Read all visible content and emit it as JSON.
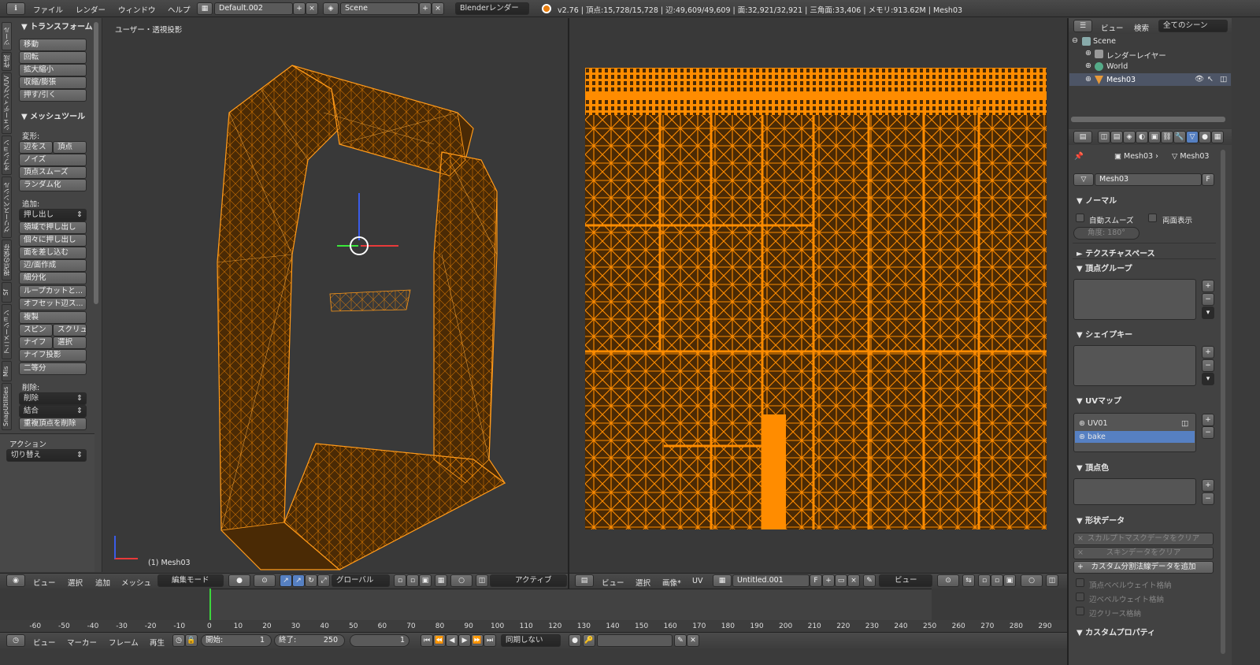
{
  "topbar": {
    "menus": [
      "ファイル",
      "レンダー",
      "ウィンドウ",
      "ヘルプ"
    ],
    "screen_layout": "Default.002",
    "scene": "Scene",
    "render_engine": "Blenderレンダー",
    "stats": "v2.76 | 頂点:15,728/15,728 | 辺:49,609/49,609 | 面:32,921/32,921 | 三角面:33,406 | メモリ:913.62M | Mesh03"
  },
  "toolshelf": {
    "vertical_tabs": [
      "ツール",
      "作成",
      "シェーディング/UV",
      "オプション",
      "グリースペンシル",
      "視点の保存",
      "Sf",
      "アニメーション",
      "Mis",
      "SnapUtilities"
    ],
    "transform_header": "トランスフォーム",
    "transform_buttons": [
      "移動",
      "回転",
      "拡大縮小",
      "収縮/膨張",
      "押す/引く"
    ],
    "mesh_tools_header": "メッシュツール",
    "deform_label": "変形:",
    "deform_row": [
      "辺をス",
      "頂点"
    ],
    "deform_buttons": [
      "ノイズ",
      "頂点スムーズ",
      "ランダム化"
    ],
    "add_label": "追加:",
    "extrude_dropdown": "押し出し",
    "add_buttons": [
      "領域で押し出し",
      "個々に押し出し",
      "面を差し込む",
      "辺/面作成",
      "細分化",
      "ループカットと...",
      "オフセット辺ス...",
      "複製"
    ],
    "spin_row": [
      "スピン",
      "スクリュ"
    ],
    "knife_row": [
      "ナイフ",
      "選択"
    ],
    "add_buttons2": [
      "ナイフ投影",
      "二等分"
    ],
    "remove_label": "削除:",
    "remove_dropdowns": [
      "削除",
      "結合"
    ],
    "remove_button": "重複頂点を削除",
    "action_label": "アクション",
    "action_dropdown": "切り替え"
  },
  "viewport": {
    "label": "ユーザー・透視投影",
    "object_label": "(1) Mesh03",
    "header": {
      "view": "ビュー",
      "select": "選択",
      "add": "追加",
      "mesh": "メッシュ",
      "mode": "編集モード",
      "orientation": "グローバル",
      "pivot": "アクティブ"
    }
  },
  "uv_editor": {
    "header": {
      "view": "ビュー",
      "select": "選択",
      "image": "画像*",
      "uv": "UV",
      "image_name": "Untitled.001",
      "fake": "F",
      "view2": "ビュー"
    }
  },
  "outliner": {
    "header": {
      "view": "ビュー",
      "search": "検索",
      "filter": "全てのシーン"
    },
    "items": [
      "Scene",
      "レンダーレイヤー",
      "World",
      "Mesh03"
    ]
  },
  "properties": {
    "breadcrumb": [
      "Mesh03",
      "Mesh03"
    ],
    "datablock": "Mesh03",
    "datablock_fake": "F",
    "normals_header": "ノーマル",
    "auto_smooth": "自動スムーズ",
    "double_sided": "両面表示",
    "angle_label": "角度:",
    "angle_value": "180°",
    "texture_space": "テクスチャスペース",
    "vertex_groups": "頂点グループ",
    "shape_keys": "シェイプキー",
    "uv_maps": "UVマップ",
    "uv_map_items": [
      "UV01",
      "bake"
    ],
    "vertex_colors": "頂点色",
    "geometry_data": "形状データ",
    "clear_sculpt": "スカルプトマスクデータをクリア",
    "clear_skin": "スキンデータをクリア",
    "add_custom_normals": "カスタム分割法線データを追加",
    "store_vertex_bevel": "頂点ベベルウェイト格納",
    "store_edge_bevel": "辺ベベルウェイト格納",
    "store_edge_crease": "辺クリース格納",
    "custom_props": "カスタムプロパティ"
  },
  "timeline": {
    "ticks": [
      "-60",
      "-50",
      "-40",
      "-30",
      "-20",
      "-10",
      "0",
      "10",
      "20",
      "30",
      "40",
      "50",
      "60",
      "70",
      "80",
      "90",
      "100",
      "110",
      "120",
      "130",
      "140",
      "150",
      "160",
      "170",
      "180",
      "190",
      "200",
      "210",
      "220",
      "230",
      "240",
      "250",
      "260",
      "270",
      "280",
      "290"
    ],
    "current_frame": 1,
    "header": {
      "view": "ビュー",
      "marker": "マーカー",
      "frame": "フレーム",
      "playback": "再生",
      "start_label": "開始:",
      "start": "1",
      "end_label": "終了:",
      "end": "250",
      "current": "1",
      "sync": "同期しない"
    }
  },
  "colors": {
    "accent_orange": "#ff8c00",
    "mesh_fill": "#4a2a05",
    "highlight_blue": "#5680c2"
  }
}
